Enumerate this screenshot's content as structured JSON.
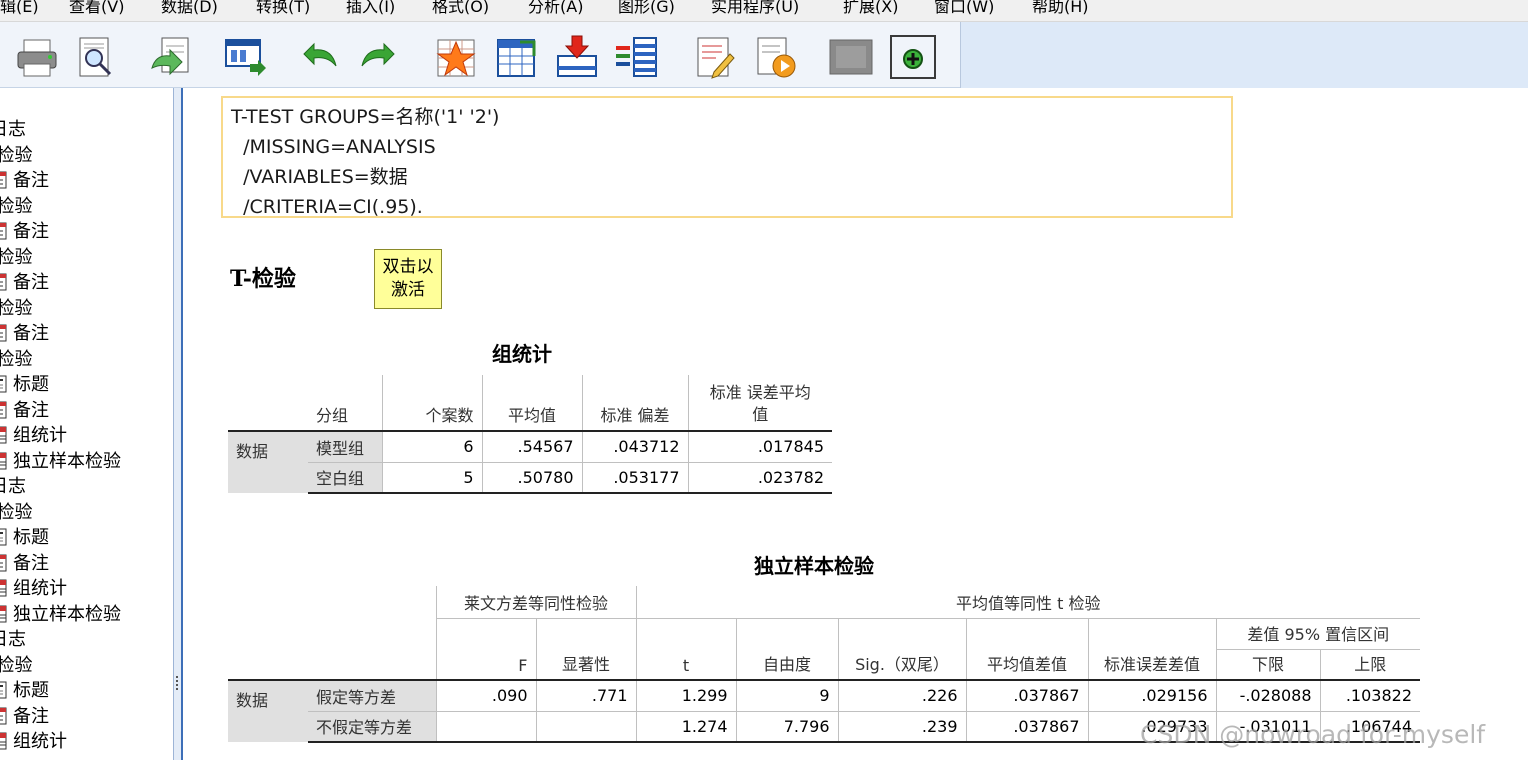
{
  "menubar": {
    "items": [
      "辑(E)",
      "查看(V)",
      "数据(D)",
      "转换(T)",
      "插入(I)",
      "格式(O)",
      "分析(A)",
      "图形(G)",
      "实用程序(U)",
      "扩展(X)",
      "窗口(W)",
      "帮助(H)"
    ]
  },
  "toolbar": {
    "buttons": [
      "print-icon",
      "print-preview-icon",
      "export-icon",
      "recall-dialog-icon",
      "undo-icon",
      "redo-icon",
      "go-to-data-icon",
      "go-to-case-icon",
      "insert-variable-icon",
      "variables-icon",
      "edit-output-icon",
      "run-script-icon",
      "disabled-icon",
      "designate-window-icon"
    ]
  },
  "tree": {
    "items": [
      {
        "label": "日志",
        "icon": "log-icon"
      },
      {
        "label": "-检验",
        "icon": ""
      },
      {
        "label": "备注",
        "icon": "notes-icon"
      },
      {
        "label": "-检验",
        "icon": ""
      },
      {
        "label": "备注",
        "icon": "notes-icon"
      },
      {
        "label": "-检验",
        "icon": ""
      },
      {
        "label": "备注",
        "icon": "notes-icon"
      },
      {
        "label": "-检验",
        "icon": ""
      },
      {
        "label": "备注",
        "icon": "notes-icon"
      },
      {
        "label": "-检验",
        "icon": ""
      },
      {
        "label": "标题",
        "icon": "title-icon"
      },
      {
        "label": "备注",
        "icon": "notes-icon"
      },
      {
        "label": "组统计",
        "icon": "table-icon"
      },
      {
        "label": "独立样本检验",
        "icon": "table-icon"
      },
      {
        "label": "日志",
        "icon": ""
      },
      {
        "label": "-检验",
        "icon": ""
      },
      {
        "label": "标题",
        "icon": "title-icon"
      },
      {
        "label": "备注",
        "icon": "notes-icon"
      },
      {
        "label": "组统计",
        "icon": "table-icon"
      },
      {
        "label": "独立样本检验",
        "icon": "table-icon"
      },
      {
        "label": "日志",
        "icon": ""
      },
      {
        "label": "-检验",
        "icon": ""
      },
      {
        "label": "标题",
        "icon": "title-icon"
      },
      {
        "label": "备注",
        "icon": "notes-icon"
      },
      {
        "label": "组统计",
        "icon": "table-icon"
      }
    ]
  },
  "syntax": {
    "lines": [
      "T-TEST GROUPS=名称('1' '2')",
      "  /MISSING=ANALYSIS",
      "  /VARIABLES=数据",
      "  /CRITERIA=CI(.95)."
    ]
  },
  "heading": "T-检验",
  "activate_note": {
    "line1": "双击以",
    "line2": "激活"
  },
  "group_stats": {
    "title": "组统计",
    "headers": [
      "分组",
      "个案数",
      "平均值",
      "标准 偏差",
      "标准 误差平均",
      "值"
    ],
    "row_label": "数据",
    "rows": [
      {
        "group": "模型组",
        "n": "6",
        "mean": ".54567",
        "sd": ".043712",
        "se": ".017845"
      },
      {
        "group": "空白组",
        "n": "5",
        "mean": ".50780",
        "sd": ".053177",
        "se": ".023782"
      }
    ]
  },
  "ind_test": {
    "title": "独立样本检验",
    "levene_header": "莱文方差等同性检验",
    "ttest_header": "平均值等同性 t 检验",
    "ci_header": "差值 95% 置信区间",
    "headers": [
      "F",
      "显著性",
      "t",
      "自由度",
      "Sig.（双尾）",
      "平均值差值",
      "标准误差差值",
      "下限",
      "上限"
    ],
    "row_label": "数据",
    "rows": [
      {
        "label": "假定等方差",
        "F": ".090",
        "sig": ".771",
        "t": "1.299",
        "df": "9",
        "sig2": ".226",
        "md": ".037867",
        "sed": ".029156",
        "lo": "-.028088",
        "hi": ".103822"
      },
      {
        "label": "不假定等方差",
        "F": "",
        "sig": "",
        "t": "1.274",
        "df": "7.796",
        "sig2": ".239",
        "md": ".037867",
        "sed": ".029733",
        "lo": "-.031011",
        "hi": ".106744"
      }
    ]
  },
  "watermark": "CSDN @nowroad for-myself"
}
